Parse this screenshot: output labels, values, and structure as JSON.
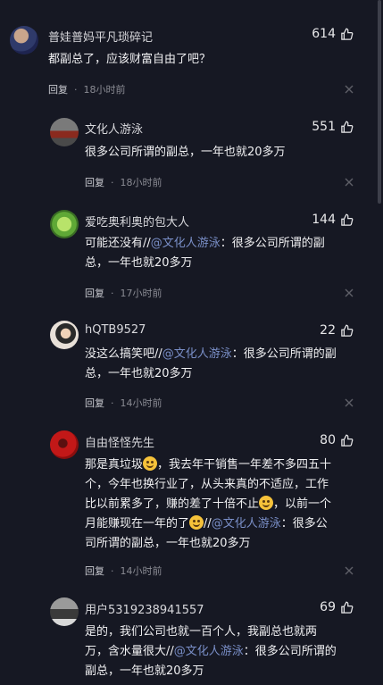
{
  "comments": [
    {
      "user": "普娃普妈平凡琐碎记",
      "likes": "614",
      "text": "都副总了，应该财富自由了吧？",
      "reply_label": "回复",
      "time": "18小时前"
    },
    {
      "user": "文化人游泳",
      "likes": "551",
      "text": "很多公司所谓的副总，一年也就20多万",
      "reply_label": "回复",
      "time": "18小时前"
    },
    {
      "user": "爱吃奥利奥的包大人",
      "likes": "144",
      "text_prefix": "可能还没有//",
      "mention": "@文化人游泳",
      "text_suffix": "：很多公司所谓的副总，一年也就20多万",
      "reply_label": "回复",
      "time": "17小时前"
    },
    {
      "user": "hQTB9527",
      "likes": "22",
      "text_prefix": "没这么搞笑吧//",
      "mention": "@文化人游泳",
      "text_suffix": "：很多公司所谓的副总，一年也就20多万",
      "reply_label": "回复",
      "time": "14小时前"
    },
    {
      "user": "自由怪怪先生",
      "likes": "80",
      "text_part1": "那是真垃圾",
      "text_part2": "，我去年干销售一年差不多四五十个，今年也换行业了，从头来真的不适应，工作比以前累多了，赚的差了十倍不止",
      "text_part3": "，以前一个月能赚现在一年的了",
      "text_part4": "//",
      "mention": "@文化人游泳",
      "text_suffix": "：很多公司所谓的副总，一年也就20多万",
      "reply_label": "回复",
      "time": "14小时前"
    },
    {
      "user": "用户5319238941557",
      "likes": "69",
      "text_prefix": "是的，我们公司也就一百个人，我副总也就两万，含水量很大//",
      "mention": "@文化人游泳",
      "text_suffix": "：很多公司所谓的副总，一年也就20多万"
    }
  ],
  "separator": "·",
  "colors": {
    "background": "#161823",
    "mention": "#7a8fc8",
    "muted": "#8a8b93"
  },
  "icons": {
    "like": "thumbs-up-icon",
    "dismiss": "close-icon",
    "emoji_laugh": "laughing-emoji-icon"
  }
}
